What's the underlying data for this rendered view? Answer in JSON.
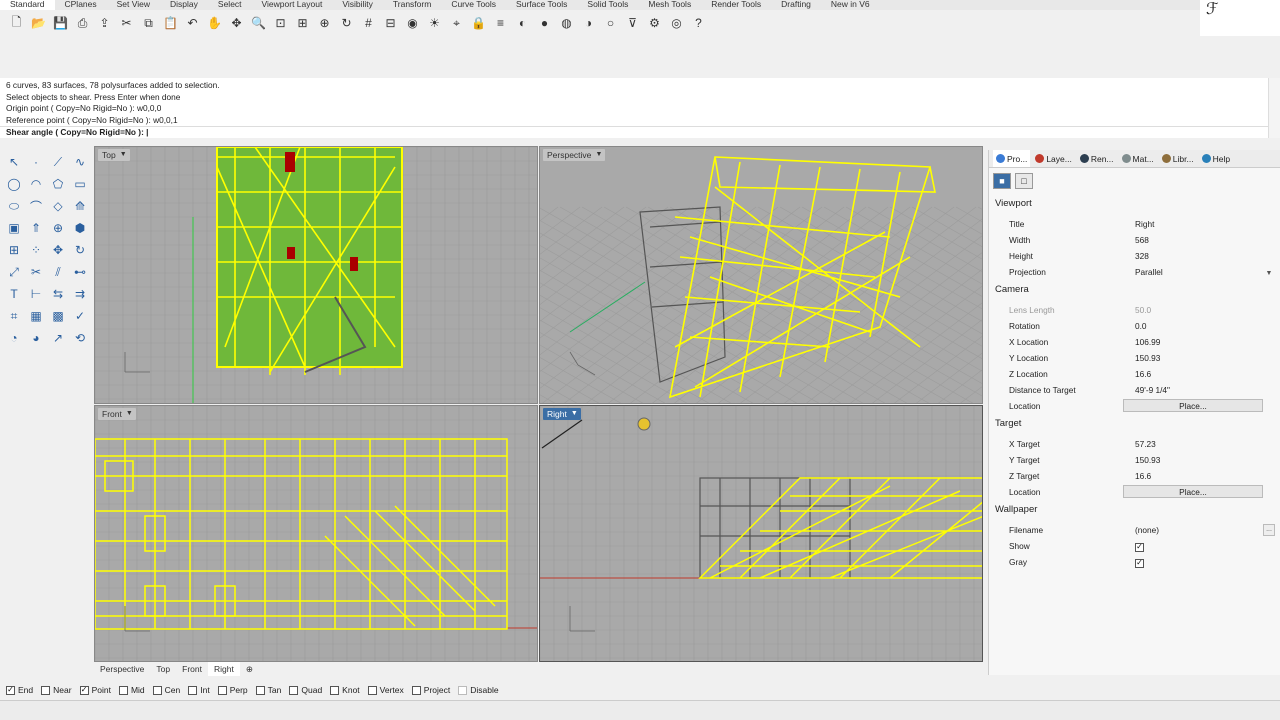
{
  "tabs": [
    "Standard",
    "CPlanes",
    "Set View",
    "Display",
    "Select",
    "Viewport Layout",
    "Visibility",
    "Transform",
    "Curve Tools",
    "Surface Tools",
    "Solid Tools",
    "Mesh Tools",
    "Render Tools",
    "Drafting",
    "New in V6"
  ],
  "active_tab": "Standard",
  "toolbar_icons": [
    "new-icon",
    "open-icon",
    "save-icon",
    "print-icon",
    "import-icon",
    "cut-icon",
    "copy-icon",
    "paste-icon",
    "undo-icon",
    "pan-icon",
    "move-icon",
    "zoom-icon",
    "zoom-window-icon",
    "zoom-extents-icon",
    "zoom-selected-icon",
    "rotate-view-icon",
    "grid-icon",
    "cplane-icon",
    "camera-icon",
    "lights-icon",
    "snap-icon",
    "lock-icon",
    "layers-icon",
    "material-icon",
    "sphere-icon",
    "render-icon",
    "shade-icon",
    "ghost-icon",
    "filter-icon",
    "options-icon",
    "globe-icon",
    "help-icon"
  ],
  "command": {
    "history": [
      "6 curves, 83 surfaces, 78 polysurfaces added to selection.",
      "Select objects to shear. Press Enter when done",
      "Origin point ( Copy=No  Rigid=No ): w0,0,0",
      "Reference point ( Copy=No  Rigid=No ): w0,0,1"
    ],
    "prompt": "Shear angle ( Copy=No  Rigid=No ): |"
  },
  "viewports": {
    "top": "Top",
    "perspective": "Perspective",
    "front": "Front",
    "right": "Right"
  },
  "viewport_tabs": [
    "Perspective",
    "Top",
    "Front",
    "Right"
  ],
  "active_viewport_tab": "Right",
  "osnaps": [
    {
      "label": "End",
      "checked": true
    },
    {
      "label": "Near",
      "checked": false
    },
    {
      "label": "Point",
      "checked": true
    },
    {
      "label": "Mid",
      "checked": false
    },
    {
      "label": "Cen",
      "checked": false
    },
    {
      "label": "Int",
      "checked": false
    },
    {
      "label": "Perp",
      "checked": false
    },
    {
      "label": "Tan",
      "checked": false
    },
    {
      "label": "Quad",
      "checked": false
    },
    {
      "label": "Knot",
      "checked": false
    },
    {
      "label": "Vertex",
      "checked": false
    },
    {
      "label": "Project",
      "checked": false
    },
    {
      "label": "Disable",
      "checked": false,
      "disabled": true
    }
  ],
  "panel": {
    "tabs": [
      {
        "label": "Pro...",
        "color": "#3a7bd5"
      },
      {
        "label": "Laye...",
        "color": "#c0392b"
      },
      {
        "label": "Ren...",
        "color": "#2c3e50"
      },
      {
        "label": "Mat...",
        "color": "#7f8c8d"
      },
      {
        "label": "Libr...",
        "color": "#8e6e3c"
      },
      {
        "label": "Help",
        "color": "#2980b9"
      }
    ],
    "viewport_section": "Viewport",
    "title_label": "Title",
    "title_value": "Right",
    "width_label": "Width",
    "width_value": "568",
    "height_label": "Height",
    "height_value": "328",
    "projection_label": "Projection",
    "projection_value": "Parallel",
    "camera_section": "Camera",
    "lens_label": "Lens Length",
    "lens_value": "50.0",
    "rotation_label": "Rotation",
    "rotation_value": "0.0",
    "xloc_label": "X Location",
    "xloc_value": "106.99",
    "yloc_label": "Y Location",
    "yloc_value": "150.93",
    "zloc_label": "Z Location",
    "zloc_value": "16.6",
    "dist_label": "Distance to Target",
    "dist_value": "49'-9 1/4\"",
    "loc_label": "Location",
    "place_label": "Place...",
    "target_section": "Target",
    "xtarget_label": "X Target",
    "xtarget_value": "57.23",
    "ytarget_label": "Y Target",
    "ytarget_value": "150.93",
    "ztarget_label": "Z Target",
    "ztarget_value": "16.6",
    "tloc_label": "Location",
    "tplace_label": "Place...",
    "wallpaper_section": "Wallpaper",
    "filename_label": "Filename",
    "filename_value": "(none)",
    "browse_label": "...",
    "show_label": "Show",
    "show_checked": true,
    "gray_label": "Gray",
    "gray_checked": true
  },
  "colors": {
    "selection": "#ffff00",
    "viewport_bg": "#a9a9a9",
    "grid": "#9c9c9c",
    "active_label": "#3b6ea5",
    "x_axis": "#c0392b",
    "y_axis": "#27ae60"
  }
}
